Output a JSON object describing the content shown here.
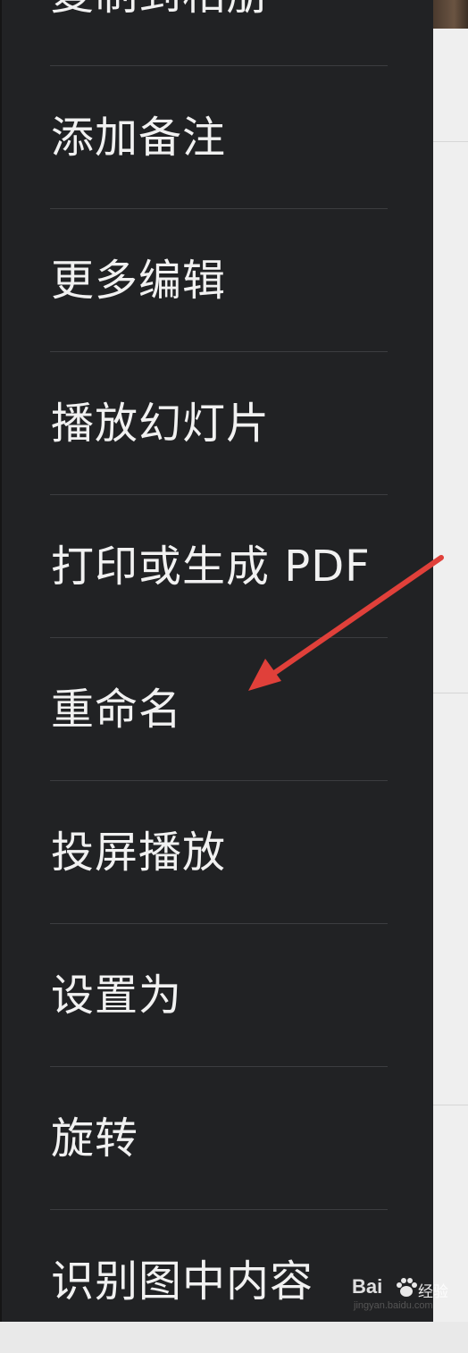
{
  "menu": {
    "items": [
      {
        "label": "复制到相册",
        "clipped": true
      },
      {
        "label": "添加备注"
      },
      {
        "label": "更多编辑"
      },
      {
        "label": "播放幻灯片"
      },
      {
        "label": "打印或生成 PDF"
      },
      {
        "label": "重命名",
        "highlighted_by_arrow": true
      },
      {
        "label": "投屏播放"
      },
      {
        "label": "设置为"
      },
      {
        "label": "旋转"
      },
      {
        "label": "识别图中内容"
      }
    ]
  },
  "annotation": {
    "arrow_color": "#e0403a",
    "points_to": "重命名"
  },
  "watermark": {
    "logo_text": "Bai",
    "logo_suffix": "经验",
    "url": "jingyan.baidu.com"
  },
  "colors": {
    "menu_background": "#212224",
    "menu_text": "#f1f1f1",
    "separator": "#3c3d40"
  }
}
